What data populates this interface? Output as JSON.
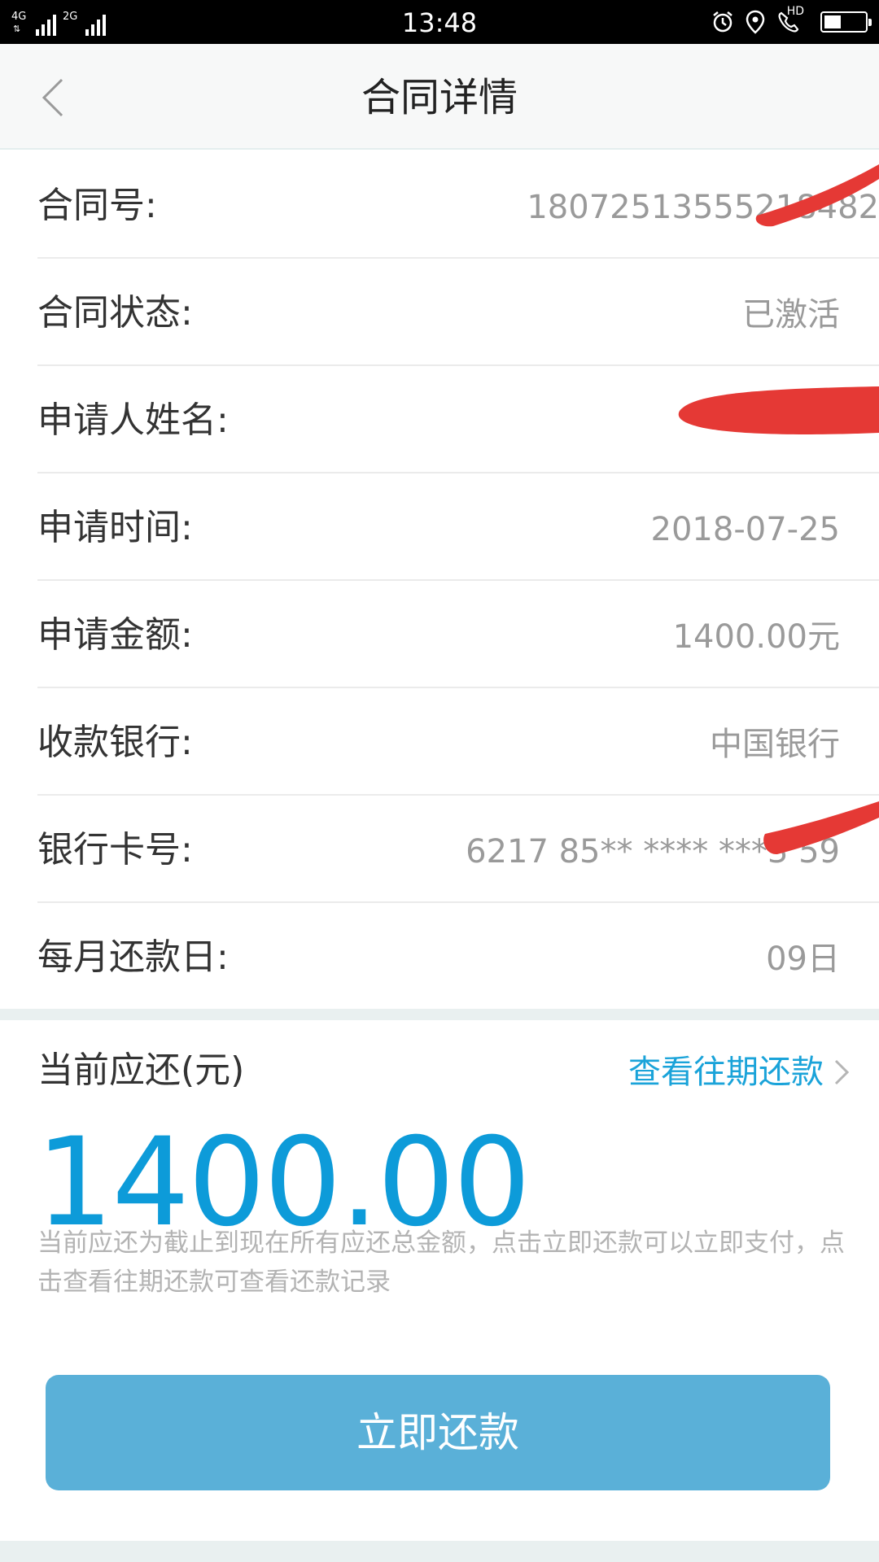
{
  "status_bar": {
    "network1": "4G",
    "network2": "4G",
    "network3": "2G",
    "time": "13:48",
    "hd": "HD",
    "battery_level": 0.4
  },
  "nav": {
    "title": "合同详情"
  },
  "rows": [
    {
      "label": "合同号:",
      "value": "18072513555218482"
    },
    {
      "label": "合同状态:",
      "value": "已激活"
    },
    {
      "label": "申请人姓名:",
      "value": ""
    },
    {
      "label": "申请时间:",
      "value": "2018-07-25"
    },
    {
      "label": "申请金额:",
      "value": "1400.00元"
    },
    {
      "label": "收款银行:",
      "value": "中国银行"
    },
    {
      "label": "银行卡号:",
      "value": "6217 85** **** ***3 59"
    },
    {
      "label": "每月还款日:",
      "value": "09日"
    }
  ],
  "repayment": {
    "title": "当前应还(元)",
    "history_link": "查看往期还款",
    "amount": "1400.00",
    "hint": "当前应还为截止到现在所有应还总金额，点击立即还款可以立即支付，点击查看往期还款可查看还款记录",
    "pay_button": "立即还款"
  },
  "colors": {
    "accent": "#0d9bd9",
    "link": "#1aa3d9",
    "button": "#5ab0d8",
    "redaction": "#e53935"
  }
}
